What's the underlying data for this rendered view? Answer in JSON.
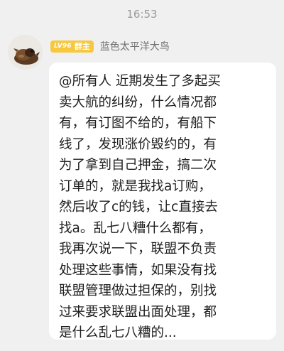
{
  "timestamp": "16:53",
  "sender": {
    "level": "LV96",
    "role": "群主",
    "name": "蓝色太平洋大鸟",
    "badge_color": "#f7c83e"
  },
  "message": {
    "lines": [
      "@所有人 近期发生了多起买",
      "卖大航的纠纷，什么情况都",
      "有，有订图不给的，有船下",
      "线了，发现涨价毁约的，有",
      "为了拿到自己押金，搞二次",
      "订单的，就是我找a订购，",
      "然后收了c的钱，让c直接去",
      "找a。乱七八糟什么都有，",
      "我再次说一下，联盟不负责",
      "处理这些事情，如果没有找",
      "联盟管理做过担保的，别找",
      "过来要求联盟出面处理，都",
      "是什么乱七八糟的..."
    ]
  },
  "colors": {
    "background": "#f0f0f0",
    "bubble": "#ffffff",
    "text": "#1f1f1f",
    "name": "#6f6f6f",
    "timestamp": "#9a9a9a"
  }
}
